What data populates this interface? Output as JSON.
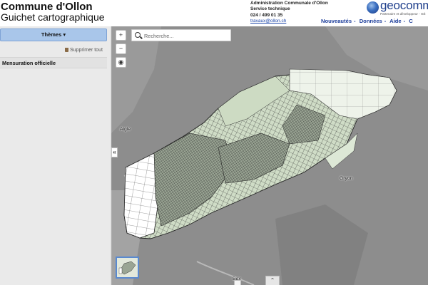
{
  "header": {
    "title": "Commune d'Ollon",
    "subtitle": "Guichet cartographique",
    "admin_line1": "Administration Communale d'Ollon",
    "admin_line2": "Service technique",
    "phone": "024 / 499 01 35",
    "email": "travaux@ollon.ch",
    "logo_text": "geocomm",
    "logo_sub": "Partenaire et développeur - GÉ",
    "nav": [
      "Nouveautés",
      "Données",
      "Aide",
      "C"
    ]
  },
  "sidebar": {
    "themes_label": "Thèmes ▾",
    "remove_all_label": "Supprimer tout",
    "active_theme": "Mensuration officielle"
  },
  "map": {
    "zoom_in": "+",
    "zoom_out": "−",
    "search_placeholder": "Recherche...",
    "collapse_glyph": "«",
    "expand_glyph": "⌃",
    "places": [
      "Aigle",
      "Gryon",
      "Bex"
    ]
  },
  "colors": {
    "accent": "#a9c6ea",
    "link": "#1b3c9a",
    "map_bg": "#8a8a8a",
    "parcel_fill": "#d8e6cf"
  }
}
